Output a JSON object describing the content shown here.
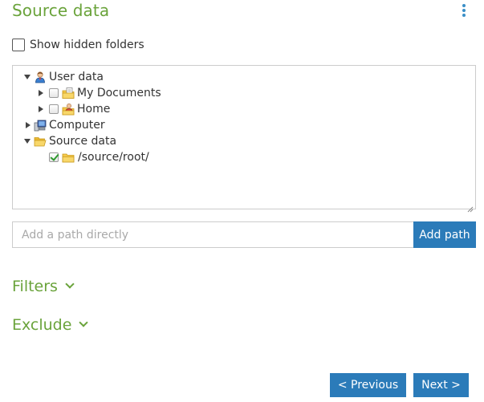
{
  "header": {
    "title": "Source data",
    "menu_icon": "kebab-menu-icon"
  },
  "options": {
    "show_hidden_label": "Show hidden folders",
    "show_hidden_checked": false
  },
  "tree": {
    "user_data": {
      "label": "User data",
      "expanded": true,
      "icon": "user-icon"
    },
    "my_documents": {
      "label": "My Documents",
      "checked": false,
      "icon": "documents-folder-icon"
    },
    "home": {
      "label": "Home",
      "checked": false,
      "icon": "home-folder-icon"
    },
    "computer": {
      "label": "Computer",
      "expanded": false,
      "icon": "computer-icon"
    },
    "source_data": {
      "label": "Source data",
      "expanded": true,
      "icon": "open-folder-icon"
    },
    "source_root": {
      "label": "/source/root/",
      "checked": true,
      "icon": "folder-icon"
    }
  },
  "path_entry": {
    "placeholder": "Add a path directly",
    "value": "",
    "add_label": "Add path"
  },
  "sections": {
    "filters": "Filters",
    "exclude": "Exclude"
  },
  "navigation": {
    "previous_label": "< Previous",
    "next_label": "Next >"
  },
  "colors": {
    "accent_green": "#6aa33b",
    "button_blue": "#2b7bb9"
  }
}
